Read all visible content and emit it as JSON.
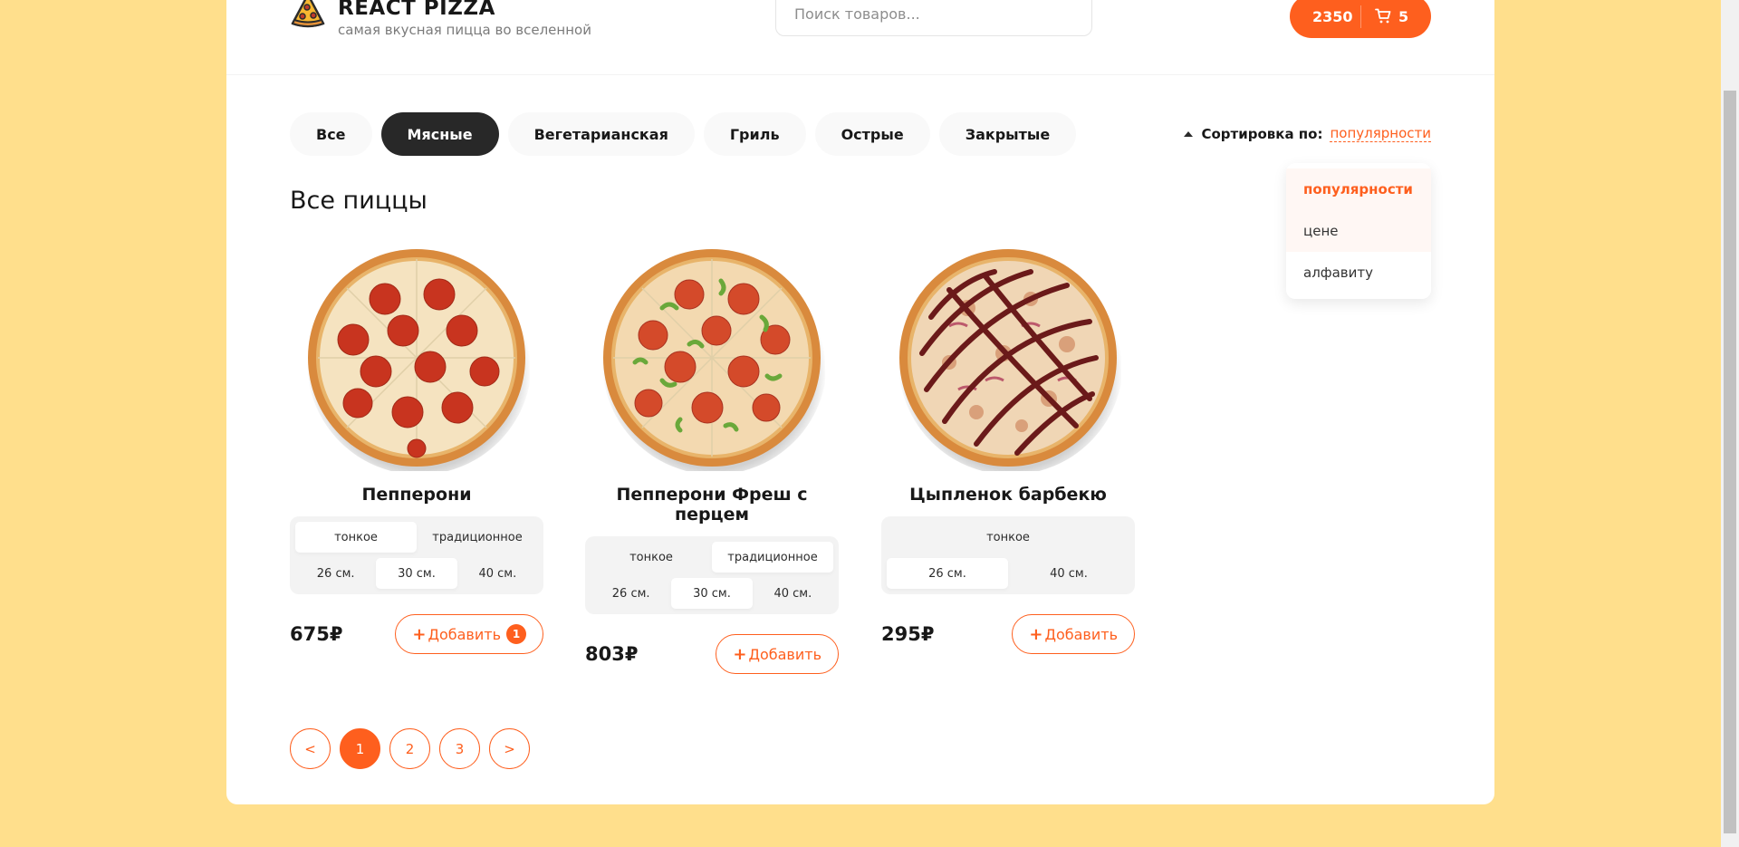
{
  "header": {
    "logo_title": "REACT PIZZA",
    "logo_subtitle": "самая вкусная пицца во вселенной",
    "search_placeholder": "Поиск товаров...",
    "cart_price": "2350",
    "cart_count": "5"
  },
  "categories": [
    "Все",
    "Мясные",
    "Вегетарианская",
    "Гриль",
    "Острые",
    "Закрытые"
  ],
  "active_category": "Мясные",
  "sort": {
    "label": "Сортировка по:",
    "value": "популярности",
    "options": [
      "популярности",
      "цене",
      "алфавиту"
    ]
  },
  "content_title": "Все пиццы",
  "pizzas": [
    {
      "title": "Пепперони",
      "types": [
        "тонкое",
        "традиционное"
      ],
      "active_type": "тонкое",
      "sizes": [
        "26 см.",
        "30 см.",
        "40 см."
      ],
      "active_size": "30 см.",
      "price": "675₽",
      "add_label": "Добавить",
      "in_cart": "1"
    },
    {
      "title": "Пепперони Фреш с перцем",
      "types": [
        "тонкое",
        "традиционное"
      ],
      "active_type": "традиционное",
      "sizes": [
        "26 см.",
        "30 см.",
        "40 см."
      ],
      "active_size": "30 см.",
      "price": "803₽",
      "add_label": "Добавить"
    },
    {
      "title": "Цыпленок барбекю",
      "types": [
        "тонкое"
      ],
      "active_type": "",
      "sizes": [
        "26 см.",
        "40 см."
      ],
      "active_size": "26 см.",
      "price": "295₽",
      "add_label": "Добавить"
    }
  ],
  "pagination": {
    "prev": "<",
    "pages": [
      "1",
      "2",
      "3"
    ],
    "next": ">",
    "current": "1"
  },
  "colors": {
    "accent": "#fe5f1e",
    "background": "#ffdf8c",
    "dark": "#282828"
  }
}
